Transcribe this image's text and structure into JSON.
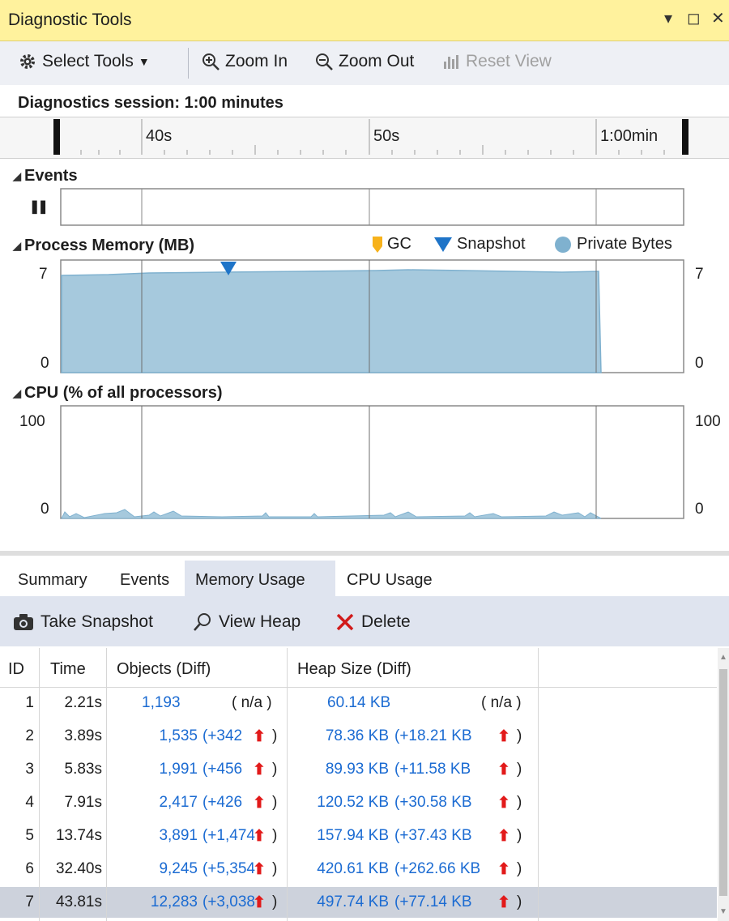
{
  "window": {
    "title": "Diagnostic Tools",
    "ctrl_dropdown": "▾",
    "ctrl_restore": "◻",
    "ctrl_close": "✕"
  },
  "toolbar": {
    "select_tools": "Select Tools",
    "zoom_in": "Zoom In",
    "zoom_out": "Zoom Out",
    "reset_view": "Reset View"
  },
  "session": {
    "label": "Diagnostics session: 1:00 minutes"
  },
  "ruler": {
    "ticks": [
      "40s",
      "50s",
      "1:00min"
    ]
  },
  "events": {
    "title": "Events",
    "pause_icon": "❚❚"
  },
  "memory": {
    "title": "Process Memory (MB)",
    "ymax": "7",
    "ymin": "0",
    "legend": {
      "gc": "GC",
      "snapshot": "Snapshot",
      "private_bytes": "Private Bytes"
    },
    "fill_color": "#a6c9dd",
    "line_color": "#7fb1cf",
    "snapshot_color": "#1e74c8",
    "gc_color": "#f7b21b"
  },
  "cpu": {
    "title": "CPU (% of all processors)",
    "ymax": "100",
    "ymin": "0"
  },
  "tabs": {
    "summary": "Summary",
    "events": "Events",
    "memory_usage": "Memory Usage",
    "cpu_usage": "CPU Usage"
  },
  "actions": {
    "take_snapshot": "Take Snapshot",
    "view_heap": "View Heap",
    "delete": "Delete"
  },
  "table": {
    "headers": {
      "id": "ID",
      "time": "Time",
      "objects": "Objects (Diff)",
      "heap": "Heap Size (Diff)"
    },
    "rows": [
      {
        "id": "1",
        "time": "2.21s",
        "objects": "1,193",
        "objects_diff": "( n/a )",
        "heap": "60.14 KB",
        "heap_diff": "( n/a )",
        "up": false
      },
      {
        "id": "2",
        "time": "3.89s",
        "objects": "1,535",
        "objects_diff": "(+342",
        "heap": "78.36 KB",
        "heap_diff": "(+18.21 KB",
        "up": true
      },
      {
        "id": "3",
        "time": "5.83s",
        "objects": "1,991",
        "objects_diff": "(+456",
        "heap": "89.93 KB",
        "heap_diff": "(+11.58 KB",
        "up": true
      },
      {
        "id": "4",
        "time": "7.91s",
        "objects": "2,417",
        "objects_diff": "(+426",
        "heap": "120.52 KB",
        "heap_diff": "(+30.58 KB",
        "up": true
      },
      {
        "id": "5",
        "time": "13.74s",
        "objects": "3,891",
        "objects_diff": "(+1,474",
        "heap": "157.94 KB",
        "heap_diff": "(+37.43 KB",
        "up": true
      },
      {
        "id": "6",
        "time": "32.40s",
        "objects": "9,245",
        "objects_diff": "(+5,354",
        "heap": "420.61 KB",
        "heap_diff": "(+262.66 KB",
        "up": true
      },
      {
        "id": "7",
        "time": "43.81s",
        "objects": "12,283",
        "objects_diff": "(+3,038",
        "heap": "497.74 KB",
        "heap_diff": "(+77.14 KB",
        "up": true
      }
    ]
  }
}
